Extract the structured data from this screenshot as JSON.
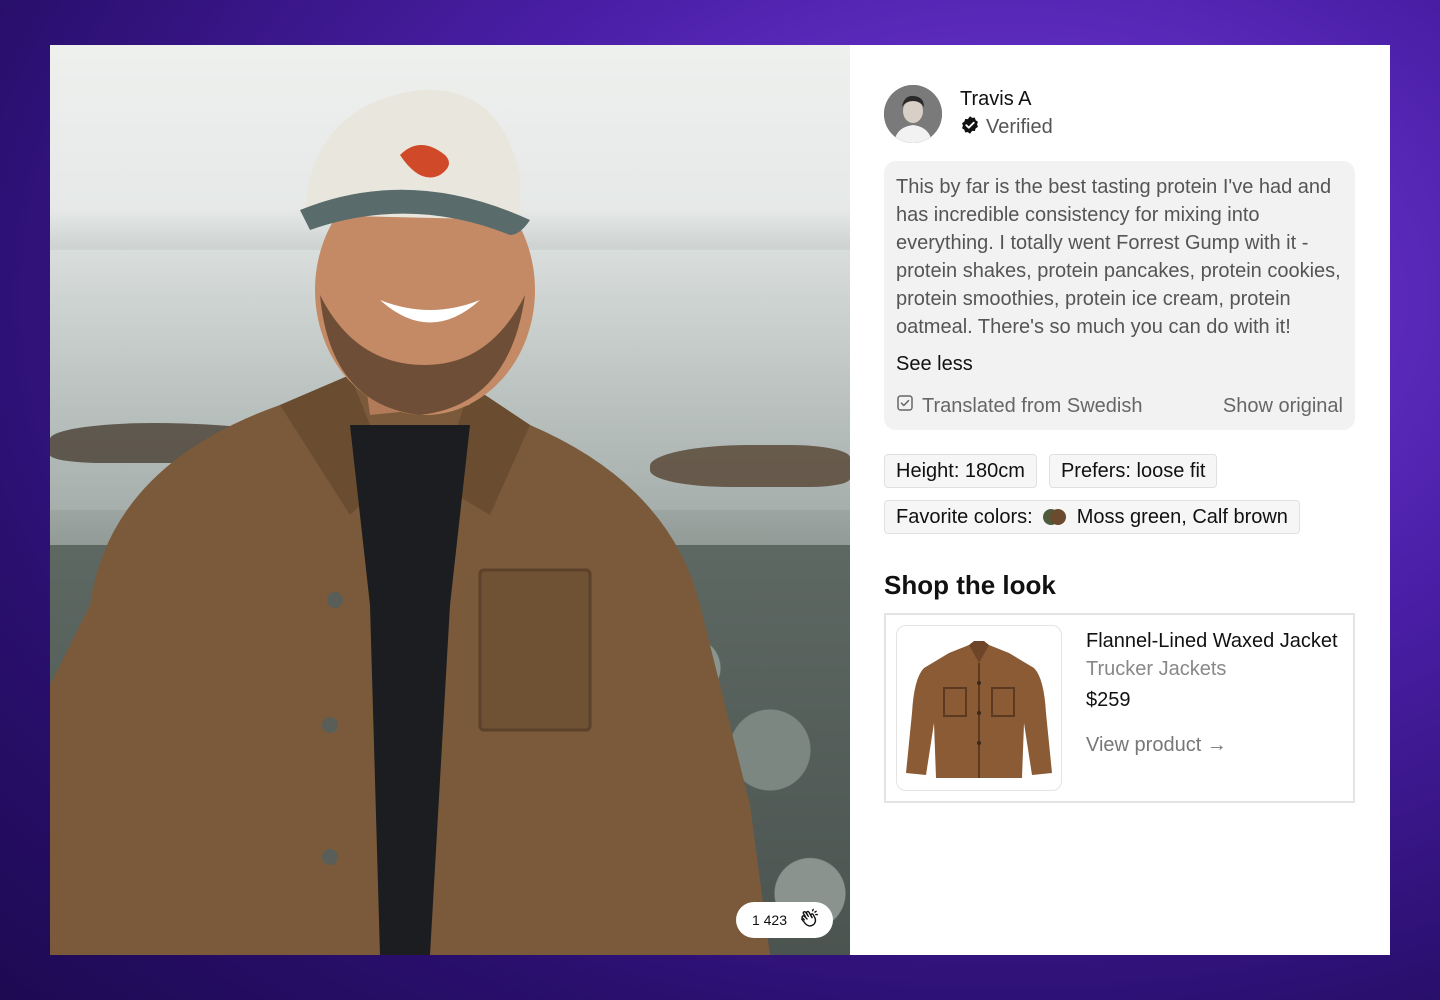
{
  "reaction": {
    "count": "1 423",
    "icon": "clapping-hands-icon"
  },
  "author": {
    "name": "Travis A",
    "verified_label": "Verified",
    "verified_icon": "verified-badge-icon"
  },
  "review": {
    "text": "This by far is the best tasting protein I've had and has incredible consistency for mixing into everything. I totally went Forrest Gump with it - protein shakes, protein pancakes, protein cookies, protein smoothies, protein ice cream, protein oatmeal. There's so much you can do with it!",
    "see_less": "See less",
    "translated_label": "Translated from Swedish",
    "show_original": "Show original"
  },
  "tags": {
    "height": "Height: 180cm",
    "fit": "Prefers: loose fit",
    "colors_label": "Favorite colors:",
    "colors_value": "Moss green, Calf brown",
    "swatch_colors": [
      "#4e5a3c",
      "#6b4a2e"
    ]
  },
  "shop": {
    "title": "Shop the look",
    "product": {
      "name": "Flannel-Lined Waxed Jacket",
      "category": "Trucker Jackets",
      "price": "$259",
      "link": "View product →"
    }
  },
  "colors": {
    "background_accent": "#6a35d4",
    "card": "#ffffff",
    "review_bg": "#f2f2f2"
  }
}
